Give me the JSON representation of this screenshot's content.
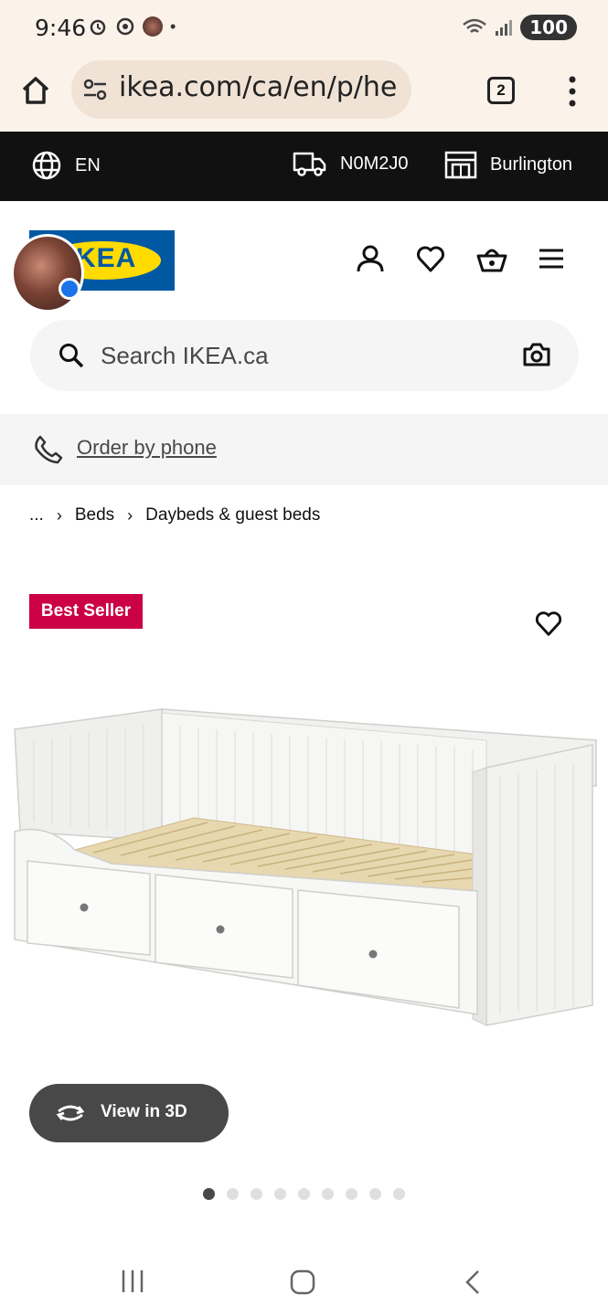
{
  "status_bar": {
    "time": "9:46",
    "battery": "100"
  },
  "browser": {
    "url": "ikea.com/ca/en/p/he",
    "tab_count": "2"
  },
  "top_bar": {
    "language": "EN",
    "postal_code": "N0M2J0",
    "store": "Burlington"
  },
  "header": {
    "logo_text": "IKEA"
  },
  "search": {
    "placeholder": "Search IKEA.ca"
  },
  "order_by_phone": "Order by phone",
  "breadcrumb": [
    "...",
    "Beds",
    "Daybeds & guest beds"
  ],
  "product": {
    "badge": "Best Seller",
    "view_3d": "View in 3D",
    "image_count": 9,
    "active_image": 1
  },
  "colors": {
    "badge": "#cc0044",
    "top_bar": "#111111",
    "browser_bg": "#fbf2ea",
    "view3d_bg": "#484848",
    "ikea_blue": "#0058a3",
    "ikea_yellow": "#ffdb00"
  },
  "icons": [
    "home-icon",
    "site-settings-icon",
    "more-vert-icon",
    "globe-icon",
    "truck-icon",
    "store-icon",
    "profile-icon",
    "heart-icon",
    "cart-icon",
    "menu-icon",
    "search-icon",
    "camera-icon",
    "phone-icon",
    "rotate-3d-icon"
  ]
}
